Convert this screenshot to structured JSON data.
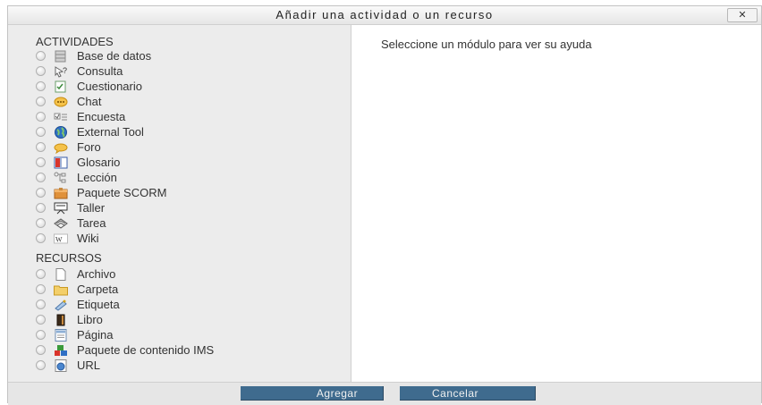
{
  "dialog": {
    "title": "Añadir una actividad o un recurso",
    "close_label": "✕",
    "help_text": "Seleccione un módulo para ver su ayuda"
  },
  "activities": {
    "heading": "ACTIVIDADES",
    "items": [
      {
        "label": "Base de datos",
        "icon": "database-icon"
      },
      {
        "label": "Consulta",
        "icon": "choice-icon"
      },
      {
        "label": "Cuestionario",
        "icon": "quiz-icon"
      },
      {
        "label": "Chat",
        "icon": "chat-icon"
      },
      {
        "label": "Encuesta",
        "icon": "survey-icon"
      },
      {
        "label": "External Tool",
        "icon": "globe-icon"
      },
      {
        "label": "Foro",
        "icon": "forum-icon"
      },
      {
        "label": "Glosario",
        "icon": "glossary-icon"
      },
      {
        "label": "Lección",
        "icon": "lesson-icon"
      },
      {
        "label": "Paquete SCORM",
        "icon": "scorm-icon"
      },
      {
        "label": "Taller",
        "icon": "workshop-icon"
      },
      {
        "label": "Tarea",
        "icon": "assignment-icon"
      },
      {
        "label": "Wiki",
        "icon": "wiki-icon"
      }
    ]
  },
  "resources": {
    "heading": "RECURSOS",
    "items": [
      {
        "label": "Archivo",
        "icon": "file-icon"
      },
      {
        "label": "Carpeta",
        "icon": "folder-icon"
      },
      {
        "label": "Etiqueta",
        "icon": "label-icon"
      },
      {
        "label": "Libro",
        "icon": "book-icon"
      },
      {
        "label": "Página",
        "icon": "page-icon"
      },
      {
        "label": "Paquete de contenido IMS",
        "icon": "ims-icon"
      },
      {
        "label": "URL",
        "icon": "url-icon"
      }
    ]
  },
  "footer": {
    "add_label": "Agregar",
    "cancel_label": "Cancelar"
  }
}
